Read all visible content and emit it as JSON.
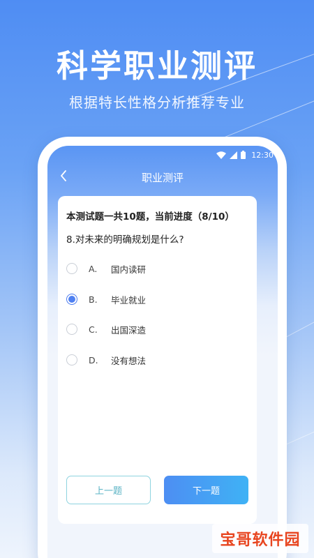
{
  "hero": {
    "title": "科学职业测评",
    "subtitle": "根据特长性格分析推荐专业"
  },
  "status_bar": {
    "time": "12:30",
    "icons": [
      "wifi-icon",
      "cellular-signal-icon",
      "battery-icon"
    ]
  },
  "nav": {
    "back_icon": "chevron-left-icon",
    "title": "职业测评"
  },
  "quiz": {
    "progress": "本测试题一共10题，当前进度（8/10）",
    "question": "8.对未来的明确规划是什么?",
    "options": [
      {
        "key": "A.",
        "text": "国内读研",
        "selected": false
      },
      {
        "key": "B.",
        "text": "毕业就业",
        "selected": true
      },
      {
        "key": "C.",
        "text": "出国深造",
        "selected": false
      },
      {
        "key": "D.",
        "text": "没有想法",
        "selected": false
      }
    ],
    "prev_label": "上一题",
    "next_label": "下一题"
  },
  "watermark": {
    "text": "宝哥软件园"
  },
  "colors": {
    "primary": "#4f80f1",
    "accent_cyan": "#3fb2f5",
    "prev_border": "#8ed3df",
    "watermark_red": "#e8451f"
  }
}
